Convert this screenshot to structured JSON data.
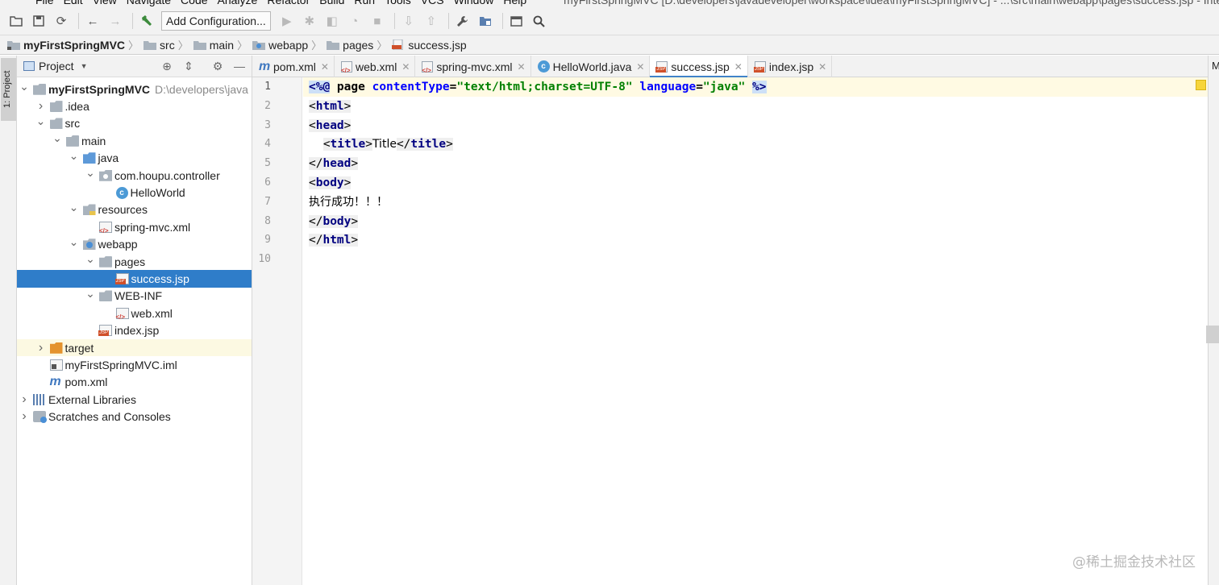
{
  "menubar": {
    "items": [
      "File",
      "Edit",
      "View",
      "Navigate",
      "Code",
      "Analyze",
      "Refactor",
      "Build",
      "Run",
      "Tools",
      "VCS",
      "Window",
      "Help"
    ],
    "window_title": "myFirstSpringMVC [D:\\developers\\javadeveloper\\workspace\\idea\\myFirstSpringMVC] - ...\\src\\main\\webapp\\pages\\success.jsp - IntelliJ"
  },
  "toolbar": {
    "add_configuration_label": "Add Configuration..."
  },
  "breadcrumb": [
    "myFirstSpringMVC",
    "src",
    "main",
    "webapp",
    "pages",
    "success.jsp"
  ],
  "left_stripe": {
    "project_tab_label": "1: Project"
  },
  "project_panel": {
    "title": "Project",
    "tree": [
      {
        "name": "myFirstSpringMVC",
        "path": "D:\\developers\\java",
        "depth": 0,
        "arrow": "down",
        "icon": "project-folder-icon"
      },
      {
        "name": ".idea",
        "depth": 1,
        "arrow": "right",
        "icon": "folder-icon"
      },
      {
        "name": "src",
        "depth": 1,
        "arrow": "down",
        "icon": "folder-icon"
      },
      {
        "name": "main",
        "depth": 2,
        "arrow": "down",
        "icon": "folder-icon"
      },
      {
        "name": "java",
        "depth": 3,
        "arrow": "down",
        "icon": "source-folder-icon"
      },
      {
        "name": "com.houpu.controller",
        "depth": 4,
        "arrow": "down",
        "icon": "package-icon"
      },
      {
        "name": "HelloWorld",
        "depth": 5,
        "arrow": "none",
        "icon": "class-icon"
      },
      {
        "name": "resources",
        "depth": 3,
        "arrow": "down",
        "icon": "resources-folder-icon"
      },
      {
        "name": "spring-mvc.xml",
        "depth": 4,
        "arrow": "none",
        "icon": "xml-file-icon"
      },
      {
        "name": "webapp",
        "depth": 3,
        "arrow": "down",
        "icon": "web-folder-icon"
      },
      {
        "name": "pages",
        "depth": 4,
        "arrow": "down",
        "icon": "folder-icon"
      },
      {
        "name": "success.jsp",
        "depth": 5,
        "arrow": "none",
        "icon": "jsp-file-icon",
        "selected": true
      },
      {
        "name": "WEB-INF",
        "depth": 4,
        "arrow": "down",
        "icon": "folder-icon"
      },
      {
        "name": "web.xml",
        "depth": 5,
        "arrow": "none",
        "icon": "xml-file-icon"
      },
      {
        "name": "index.jsp",
        "depth": 4,
        "arrow": "none",
        "icon": "jsp-file-icon"
      },
      {
        "name": "target",
        "depth": 1,
        "arrow": "right",
        "icon": "excluded-folder-icon",
        "excluded": true
      },
      {
        "name": "myFirstSpringMVC.iml",
        "depth": 1,
        "arrow": "none",
        "icon": "iml-file-icon"
      },
      {
        "name": "pom.xml",
        "depth": 1,
        "arrow": "none",
        "icon": "maven-file-icon"
      },
      {
        "name": "External Libraries",
        "depth": 0,
        "arrow": "right",
        "icon": "libraries-icon"
      },
      {
        "name": "Scratches and Consoles",
        "depth": 0,
        "arrow": "right",
        "icon": "scratches-icon"
      }
    ]
  },
  "editor_tabs": [
    {
      "label": "pom.xml",
      "icon": "maven-file-icon"
    },
    {
      "label": "web.xml",
      "icon": "xml-file-icon"
    },
    {
      "label": "spring-mvc.xml",
      "icon": "xml-file-icon"
    },
    {
      "label": "HelloWorld.java",
      "icon": "class-icon"
    },
    {
      "label": "success.jsp",
      "icon": "jsp-file-icon",
      "active": true
    },
    {
      "label": "index.jsp",
      "icon": "jsp-file-icon"
    }
  ],
  "right_stripe": {
    "label": "M"
  },
  "editor": {
    "line_numbers": [
      "1",
      "2",
      "3",
      "4",
      "5",
      "6",
      "7",
      "8",
      "9",
      "10"
    ],
    "lines": [
      [
        {
          "t": "dir",
          "v": "<%@"
        },
        {
          "t": "plain",
          "v": " page "
        },
        {
          "t": "attr",
          "v": "contentType"
        },
        {
          "t": "plain",
          "v": "="
        },
        {
          "t": "str",
          "v": "\"text/html;charset=UTF-8\""
        },
        {
          "t": "plain",
          "v": " "
        },
        {
          "t": "attr",
          "v": "language"
        },
        {
          "t": "plain",
          "v": "="
        },
        {
          "t": "str",
          "v": "\"java\""
        },
        {
          "t": "plain",
          "v": " "
        },
        {
          "t": "dir",
          "v": "%>"
        }
      ],
      [
        {
          "t": "br",
          "v": "<"
        },
        {
          "t": "tag",
          "v": "html"
        },
        {
          "t": "br",
          "v": ">"
        }
      ],
      [
        {
          "t": "br",
          "v": "<"
        },
        {
          "t": "tag",
          "v": "head"
        },
        {
          "t": "br",
          "v": ">"
        }
      ],
      [
        {
          "t": "txt",
          "v": "    "
        },
        {
          "t": "br",
          "v": "<"
        },
        {
          "t": "tag",
          "v": "title"
        },
        {
          "t": "br",
          "v": ">"
        },
        {
          "t": "txt",
          "v": "Title"
        },
        {
          "t": "br",
          "v": "</"
        },
        {
          "t": "tag",
          "v": "title"
        },
        {
          "t": "br",
          "v": ">"
        }
      ],
      [
        {
          "t": "br",
          "v": "</"
        },
        {
          "t": "tag",
          "v": "head"
        },
        {
          "t": "br",
          "v": ">"
        }
      ],
      [
        {
          "t": "br",
          "v": "<"
        },
        {
          "t": "tag",
          "v": "body"
        },
        {
          "t": "br",
          "v": ">"
        }
      ],
      [
        {
          "t": "txt",
          "v": "执行成功！！！"
        }
      ],
      [
        {
          "t": "br",
          "v": "</"
        },
        {
          "t": "tag",
          "v": "body"
        },
        {
          "t": "br",
          "v": ">"
        }
      ],
      [
        {
          "t": "br",
          "v": "</"
        },
        {
          "t": "tag",
          "v": "html"
        },
        {
          "t": "br",
          "v": ">"
        }
      ],
      []
    ]
  },
  "watermark": "@稀土掘金技术社区",
  "colors": {
    "selection": "#2f7dc9",
    "active_tab_underline": "#4083c9",
    "tag": "#000080",
    "attribute": "#0000ff",
    "string": "#008000"
  }
}
